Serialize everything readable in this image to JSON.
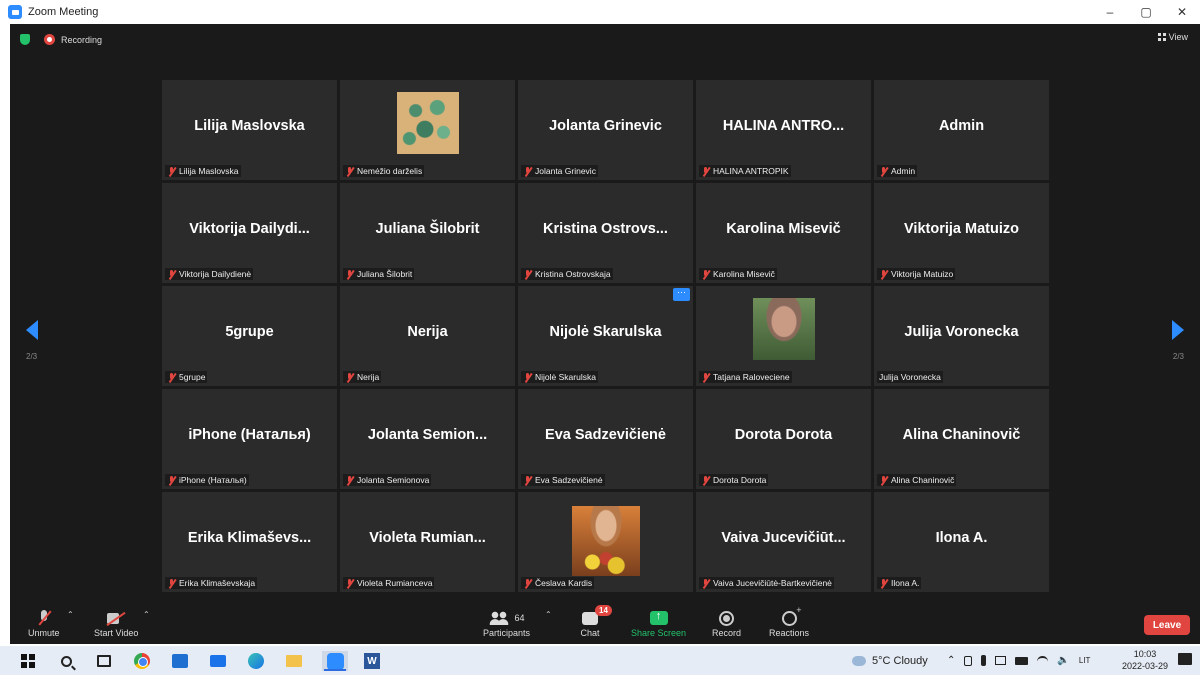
{
  "window": {
    "title": "Zoom Meeting",
    "buttons": [
      "–",
      "▢",
      "✕"
    ]
  },
  "topbar": {
    "recording_label": "Recording",
    "view_label": "View"
  },
  "pagination": {
    "left": "2/3",
    "right": "2/3"
  },
  "tiles": [
    {
      "big": "Lilija Maslovska",
      "label": "Lilija Maslovska",
      "muted": true,
      "media": "none"
    },
    {
      "big": "",
      "label": "Nemėžio darželis",
      "muted": true,
      "media": "plant"
    },
    {
      "big": "Jolanta Grinevic",
      "label": "Jolanta Grinevic",
      "muted": true,
      "media": "none"
    },
    {
      "big": "HALINA  ANTRO...",
      "label": "HALINA ANTROPIK",
      "muted": true,
      "media": "none"
    },
    {
      "big": "Admin",
      "label": "Admin",
      "muted": true,
      "media": "none"
    },
    {
      "big": "Viktorija  Dailydi...",
      "label": "Viktorija Dailydienė",
      "muted": true,
      "media": "none"
    },
    {
      "big": "Juliana Šilobrit",
      "label": "Juliana Šilobrit",
      "muted": true,
      "media": "none"
    },
    {
      "big": "Kristina  Ostrovs...",
      "label": "Kristina Ostrovskaja",
      "muted": true,
      "media": "none"
    },
    {
      "big": "Karolina Misevič",
      "label": "Karolina Misevič",
      "muted": true,
      "media": "none"
    },
    {
      "big": "Viktorija Matuizo",
      "label": "Viktorija Matuizo",
      "muted": true,
      "media": "none"
    },
    {
      "big": "5grupe",
      "label": "5grupe",
      "muted": true,
      "media": "none"
    },
    {
      "big": "Nerija",
      "label": "Nerija",
      "muted": true,
      "media": "none"
    },
    {
      "big": "Nijolė Skarulska",
      "label": "Nijolė Skarulska",
      "muted": true,
      "media": "none",
      "more": "···"
    },
    {
      "big": "",
      "label": "Tatjana Raloveciene",
      "muted": true,
      "media": "photo"
    },
    {
      "big": "Julija Voronecka",
      "label": "Julija Voronecka",
      "muted": false,
      "media": "none"
    },
    {
      "big": "iPhone (Наталья)",
      "label": "iPhone (Наталья)",
      "muted": true,
      "media": "none"
    },
    {
      "big": "Jolanta  Semion...",
      "label": "Jolanta Semionova",
      "muted": true,
      "media": "none"
    },
    {
      "big": "Eva Sadzevičienė",
      "label": "Eva Sadzevičienė",
      "muted": true,
      "media": "none"
    },
    {
      "big": "Dorota Dorota",
      "label": "Dorota Dorota",
      "muted": true,
      "media": "none"
    },
    {
      "big": "Alina Chaninovič",
      "label": "Alina Chaninovič",
      "muted": true,
      "media": "none"
    },
    {
      "big": "Erika  Klimaševs...",
      "label": "Erika Klimaševskaja",
      "muted": true,
      "media": "none"
    },
    {
      "big": "Violeta  Rumian...",
      "label": "Violeta Rumianceva",
      "muted": true,
      "media": "none"
    },
    {
      "big": "",
      "label": "Česlava Kardis",
      "muted": true,
      "media": "flowers"
    },
    {
      "big": "Vaiva  Jucevičiūt...",
      "label": "Vaiva Jucevičiūtė-Bartkevičienė",
      "muted": true,
      "media": "none"
    },
    {
      "big": "Ilona A.",
      "label": "Ilona A.",
      "muted": true,
      "media": "none"
    }
  ],
  "toolbar": {
    "unmute": "Unmute",
    "start_video": "Start Video",
    "participants": "Participants",
    "participants_count": "64",
    "chat": "Chat",
    "chat_badge": "14",
    "share_screen": "Share Screen",
    "record": "Record",
    "reactions": "Reactions",
    "leave": "Leave"
  },
  "taskbar": {
    "weather": "5°C  Cloudy",
    "language": "LIT",
    "time": "10:03",
    "date": "2022-03-29",
    "word_letter": "W"
  },
  "colors": {
    "accent": "#2d8cff",
    "leave": "#e0463f",
    "share": "#23c26a",
    "tile_bg": "#2b2b2b",
    "meeting_bg": "#1a1a1a"
  }
}
